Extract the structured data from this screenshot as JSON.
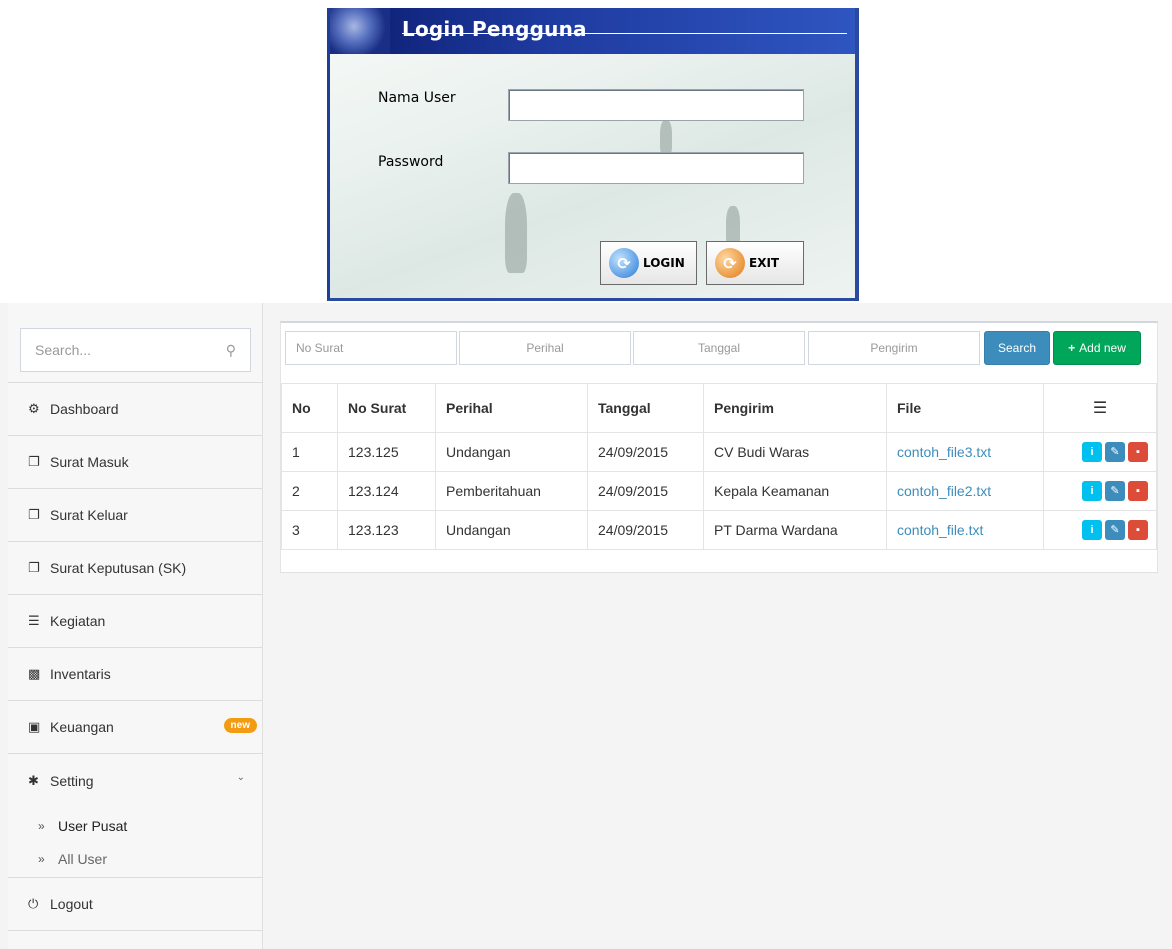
{
  "login": {
    "title": "Login Pengguna",
    "user_label": "Nama User",
    "password_label": "Password",
    "login_button": "LOGIN",
    "exit_button": "EXIT"
  },
  "sidebar": {
    "search_placeholder": "Search...",
    "items": [
      {
        "label": "Dashboard",
        "icon": "dashboard-icon"
      },
      {
        "label": "Surat Masuk",
        "icon": "copy-icon"
      },
      {
        "label": "Surat Keluar",
        "icon": "copy-icon"
      },
      {
        "label": "Surat Keputusan (SK)",
        "icon": "copy-icon"
      },
      {
        "label": "Kegiatan",
        "icon": "list-icon"
      },
      {
        "label": "Inventaris",
        "icon": "folder-open-icon"
      },
      {
        "label": "Keuangan",
        "icon": "money-icon",
        "badge": "new"
      },
      {
        "label": "Setting",
        "icon": "gear-icon"
      }
    ],
    "sub_items": [
      "User Pusat",
      "All User"
    ],
    "logout": "Logout"
  },
  "filters": {
    "no_surat": "No Surat",
    "perihal": "Perihal",
    "tanggal": "Tanggal",
    "pengirim": "Pengirim",
    "search_button": "Search",
    "add_button": "Add new"
  },
  "table": {
    "headers": [
      "No",
      "No Surat",
      "Perihal",
      "Tanggal",
      "Pengirim",
      "File"
    ],
    "rows": [
      {
        "no": "1",
        "no_surat": "123.125",
        "perihal": "Undangan",
        "tanggal": "24/09/2015",
        "pengirim": "CV Budi Waras",
        "file": "contoh_file3.txt"
      },
      {
        "no": "2",
        "no_surat": "123.124",
        "perihal": "Pemberitahuan",
        "tanggal": "24/09/2015",
        "pengirim": "Kepala Keamanan",
        "file": "contoh_file2.txt"
      },
      {
        "no": "3",
        "no_surat": "123.123",
        "perihal": "Undangan",
        "tanggal": "24/09/2015",
        "pengirim": "PT Darma Wardana",
        "file": "contoh_file.txt"
      }
    ]
  },
  "colors": {
    "primary": "#3c8dbc",
    "success": "#00a65a",
    "info": "#00c0ef",
    "danger": "#dd4b39",
    "warning": "#f39c12"
  }
}
